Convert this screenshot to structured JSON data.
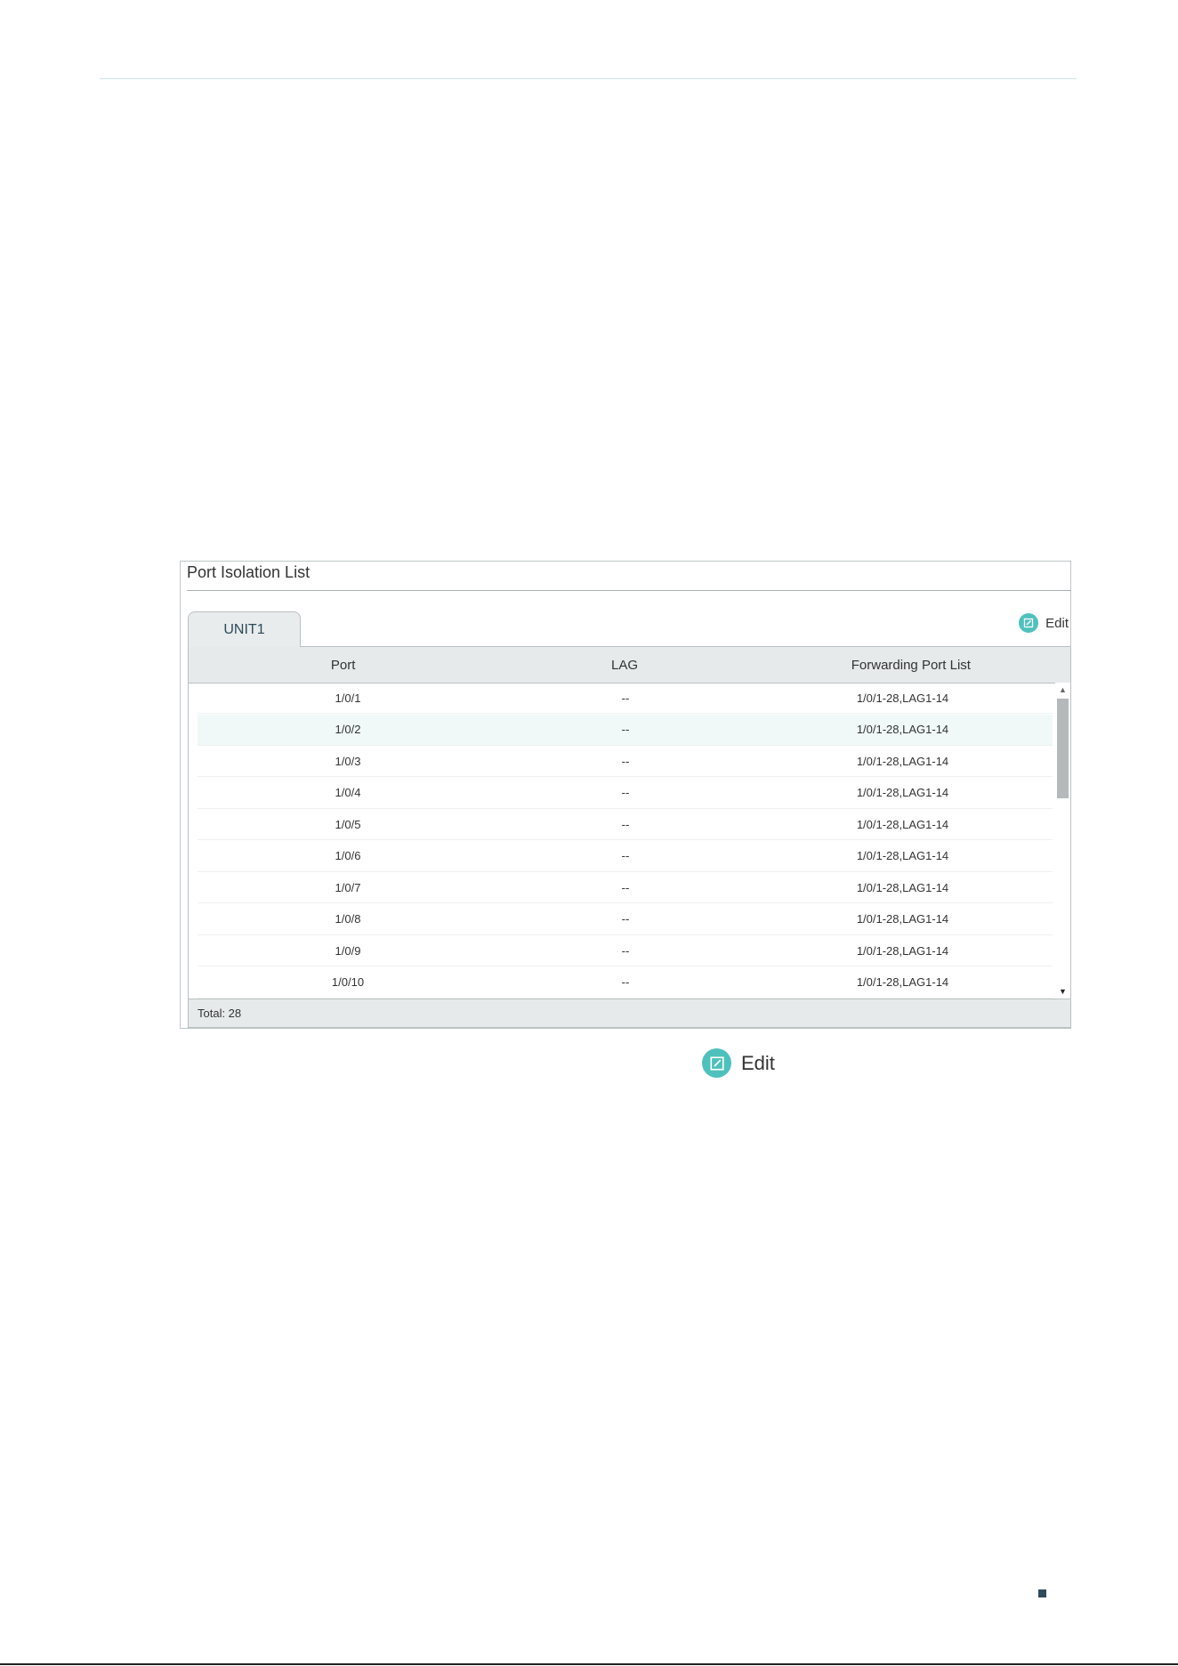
{
  "panel": {
    "title": "Port Isolation List",
    "tab_label": "UNIT1",
    "edit_label": "Edit"
  },
  "table": {
    "columns": [
      "Port",
      "LAG",
      "Forwarding Port List"
    ],
    "rows": [
      {
        "port": "1/0/1",
        "lag": "--",
        "forwarding": "1/0/1-28,LAG1-14"
      },
      {
        "port": "1/0/2",
        "lag": "--",
        "forwarding": "1/0/1-28,LAG1-14"
      },
      {
        "port": "1/0/3",
        "lag": "--",
        "forwarding": "1/0/1-28,LAG1-14"
      },
      {
        "port": "1/0/4",
        "lag": "--",
        "forwarding": "1/0/1-28,LAG1-14"
      },
      {
        "port": "1/0/5",
        "lag": "--",
        "forwarding": "1/0/1-28,LAG1-14"
      },
      {
        "port": "1/0/6",
        "lag": "--",
        "forwarding": "1/0/1-28,LAG1-14"
      },
      {
        "port": "1/0/7",
        "lag": "--",
        "forwarding": "1/0/1-28,LAG1-14"
      },
      {
        "port": "1/0/8",
        "lag": "--",
        "forwarding": "1/0/1-28,LAG1-14"
      },
      {
        "port": "1/0/9",
        "lag": "--",
        "forwarding": "1/0/1-28,LAG1-14"
      },
      {
        "port": "1/0/10",
        "lag": "--",
        "forwarding": "1/0/1-28,LAG1-14"
      }
    ],
    "highlighted_row": 1,
    "total_label": "Total: 28"
  },
  "caption": {
    "edit_label": "Edit"
  },
  "icons": {
    "edit": "edit-icon",
    "scroll_up": "scroll-up-arrow-icon",
    "scroll_down": "scroll-down-arrow-icon"
  },
  "colors": {
    "accent": "#4fc1bd",
    "header_bg": "#e7eaea",
    "row_highlight": "#f1f8f8"
  }
}
